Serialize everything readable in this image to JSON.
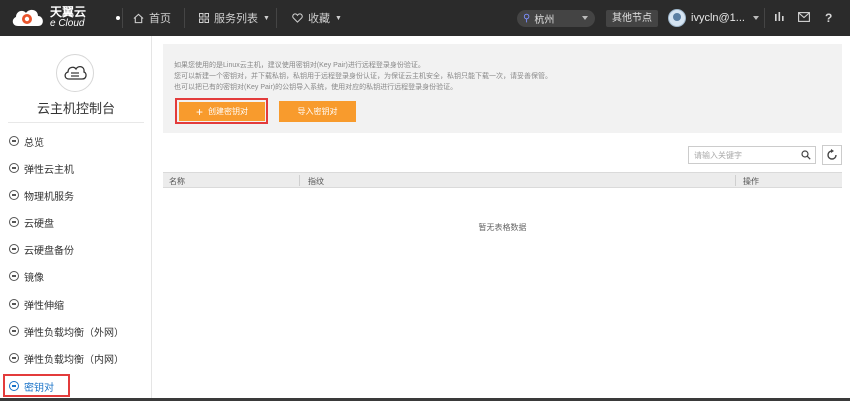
{
  "header": {
    "brand_cn": "天翼云",
    "brand_en": "e Cloud",
    "nav": [
      {
        "label": "首页",
        "icon": "home-icon"
      },
      {
        "label": "服务列表",
        "icon": "grid-icon"
      },
      {
        "label": "收藏",
        "icon": "heart-icon"
      }
    ],
    "region": "杭州",
    "other_node": "其他节点",
    "user": "ivycln@1...",
    "icons": [
      "bars-icon",
      "mail-icon",
      "help-icon"
    ]
  },
  "sidebar": {
    "title": "云主机控制台",
    "items": [
      {
        "label": "总览"
      },
      {
        "label": "弹性云主机"
      },
      {
        "label": "物理机服务"
      },
      {
        "label": "云硬盘"
      },
      {
        "label": "云硬盘备份"
      },
      {
        "label": "镜像"
      },
      {
        "label": "弹性伸缩"
      },
      {
        "label": "弹性负载均衡（外网）"
      },
      {
        "label": "弹性负载均衡（内网）"
      },
      {
        "label": "密钥对"
      }
    ],
    "active_index": 9
  },
  "notice": {
    "lines": [
      "如果您使用的是Linux云主机，建议使用密钥对(Key Pair)进行远程登录身份验证。",
      "您可以新建一个密钥对，并下载私钥，私钥用于远程登录身份认证，为保证云主机安全，私钥只能下载一次，请妥善保管。",
      "也可以把已有的密钥对(Key Pair)的公钥导入系统，使用对应的私钥进行远程登录身份验证。"
    ]
  },
  "actions": {
    "create_label": "创建密钥对",
    "import_label": "导入密钥对"
  },
  "search": {
    "placeholder": "请输入关键字"
  },
  "table": {
    "columns": [
      "名称",
      "指纹",
      "操作"
    ],
    "empty_text": "暂无表格数据"
  },
  "colors": {
    "topbar": "#2b2b2b",
    "accent_orange": "#f89b2d",
    "highlight_red": "#e33b3b",
    "active_blue": "#1a73c8"
  }
}
